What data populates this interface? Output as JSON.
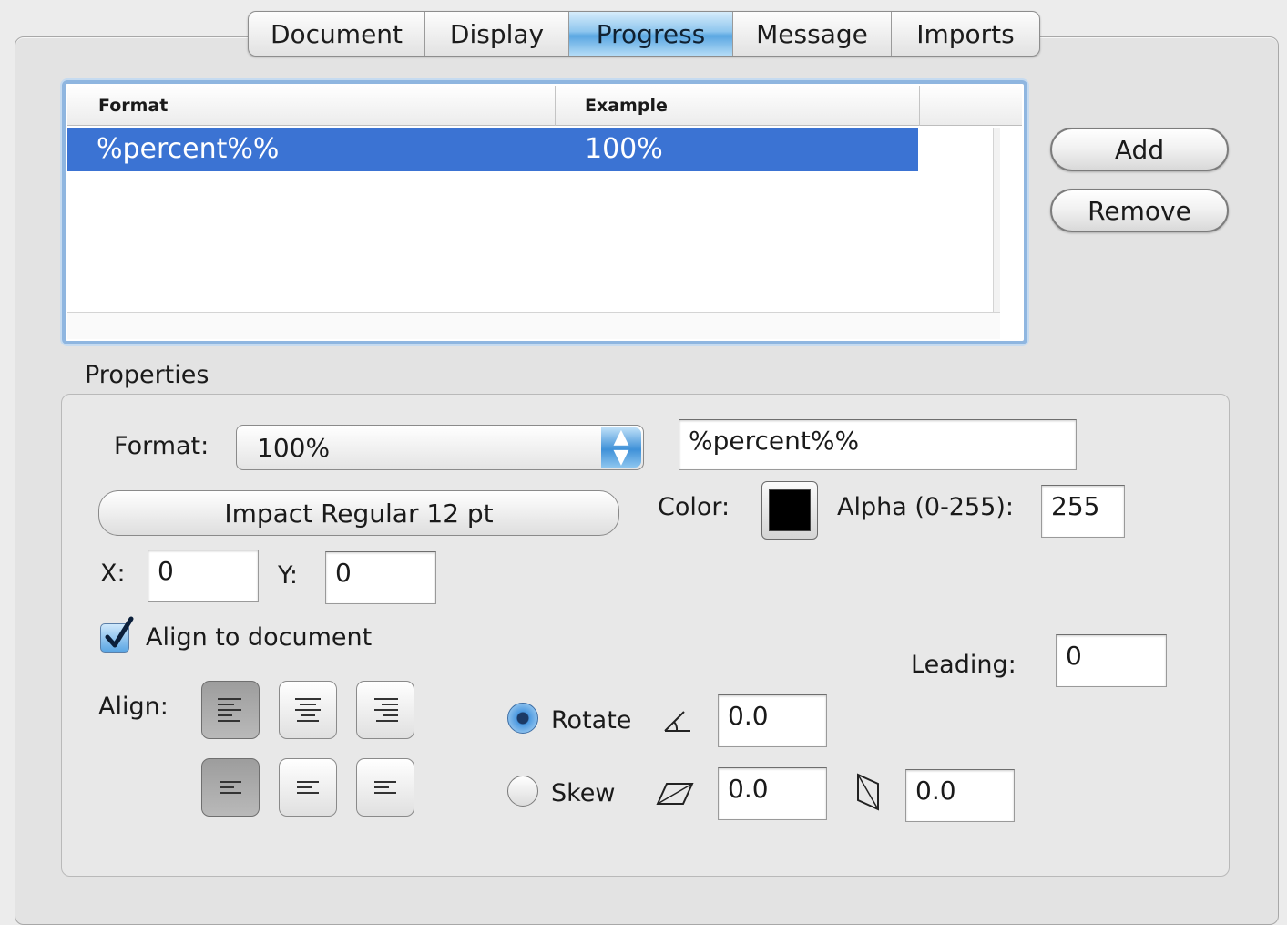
{
  "tabs": [
    {
      "label": "Document",
      "active": false
    },
    {
      "label": "Display",
      "active": false
    },
    {
      "label": "Progress",
      "active": true
    },
    {
      "label": "Message",
      "active": false
    },
    {
      "label": "Imports",
      "active": false
    }
  ],
  "format_list": {
    "columns": [
      "Format",
      "Example"
    ],
    "rows": [
      {
        "format": "%percent%%",
        "example": "100%",
        "selected": true
      }
    ]
  },
  "list_buttons": {
    "add_label": "Add",
    "remove_label": "Remove"
  },
  "properties": {
    "group_title": "Properties",
    "format_label": "Format:",
    "format_selected": "100%",
    "format_string": "%percent%%",
    "font_button_label": "Impact Regular 12 pt",
    "color_label": "Color:",
    "color_value": "#000000",
    "alpha_label": "Alpha (0-255):",
    "alpha_value": "255",
    "x_label": "X:",
    "x_value": "0",
    "y_label": "Y:",
    "y_value": "0",
    "align_to_document_label": "Align to document",
    "align_to_document_checked": true,
    "align_label": "Align:",
    "leading_label": "Leading:",
    "leading_value": "0",
    "rotate_label": "Rotate",
    "rotate_selected": true,
    "rotate_value": "0.0",
    "skew_label": "Skew",
    "skew_selected": false,
    "skew_x_value": "0.0",
    "skew_y_value": "0.0"
  },
  "colors": {
    "selection": "#3b73d3",
    "tab_active": "#5aa7e2"
  }
}
